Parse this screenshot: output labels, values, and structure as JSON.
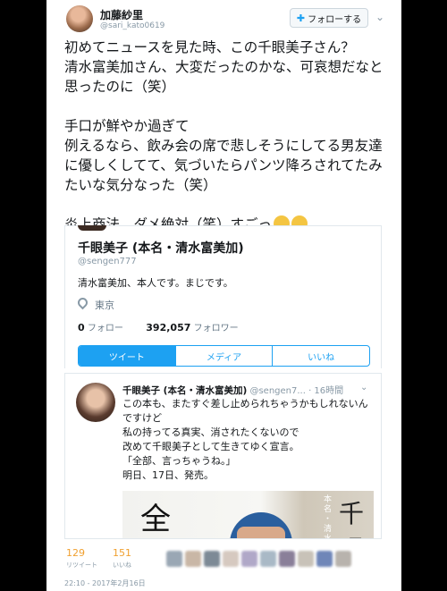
{
  "tweet": {
    "author_name": "加藤紗里",
    "author_handle": "@sari_kato0619",
    "follow_label": "フォローする",
    "text": "初めてニュースを見た時、この千眼美子さん？\n清水富美加さん、大変だったのかな、可哀想だなと思ったのに（笑）\n\n手口が鮮やか過ぎて\n例えるなら、飲み会の席で悲しそうにしてる男友達に優しくしてて、気づいたらパンツ降ろされてたみたいな気分なった（笑）\n\n炎上商法、ダメ絶対（笑）すごっ",
    "retweets": "129",
    "retweets_label": "リツイート",
    "likes": "151",
    "likes_label": "いいね",
    "timestamp": "22:10 - 2017年2月16日"
  },
  "profile": {
    "name": "千眼美子 (本名・清水富美加)",
    "handle": "@sengen777",
    "bio": "清水富美加、本人です。まじです。",
    "location": "東京",
    "following_count": "0",
    "following_label": "フォロー",
    "followers_count": "392,057",
    "followers_label": "フォロワー",
    "tabs": [
      "ツイート",
      "メディア",
      "いいね"
    ]
  },
  "embedded_tweet": {
    "name": "千眼美子 (本名・清水富美加)",
    "handle_time": "@sengen7... · 16時間",
    "text": "この本も、またすぐ差し止められちゃうかもしれないんですけど\n私の持ってる真実、消されたくないので\n改めて千眼美子として生きてゆく宣言。\n「全部、言っちゃうね。」\n明日、17日、発売。",
    "photo_glyph_left": "全",
    "photo_vertical_text": "本名・清水",
    "photo_glyph_right": "千眼"
  },
  "icons": {
    "follow": "person-add-icon",
    "menu": "chevron-down-icon",
    "location": "map-pin-icon",
    "emoji": "person-gesturing-no-emoji"
  },
  "colors": {
    "accent": "#1da1f2",
    "stat_number": "#f0a030",
    "muted": "#8899a6"
  }
}
